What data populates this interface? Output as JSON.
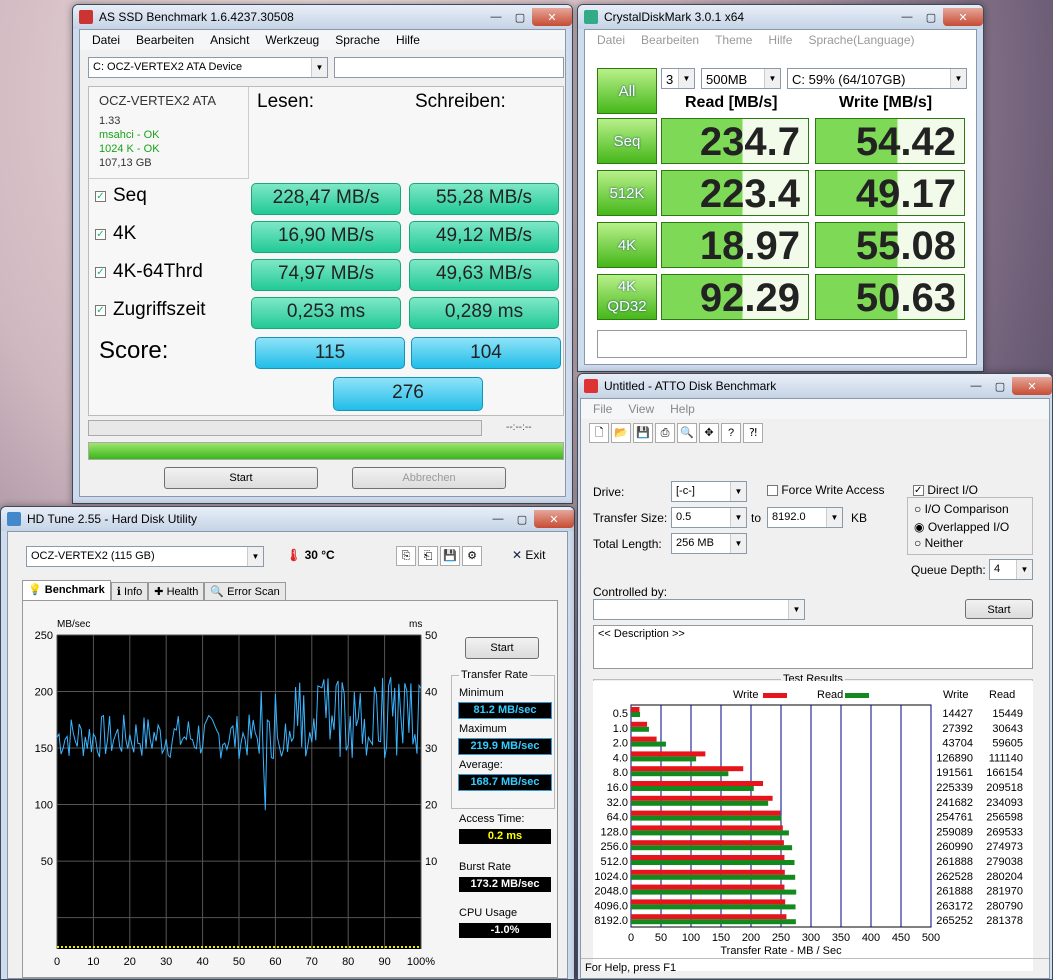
{
  "asssd": {
    "title": "AS SSD Benchmark 1.6.4237.30508",
    "menu": [
      "Datei",
      "Bearbeiten",
      "Ansicht",
      "Werkzeug",
      "Sprache",
      "Hilfe"
    ],
    "device": "C: OCZ-VERTEX2 ATA Device",
    "info": {
      "name": "OCZ-VERTEX2 ATA",
      "fw": "1.33",
      "msahci": "msahci - OK",
      "align": "1024 K - OK",
      "size": "107,13 GB"
    },
    "col_read": "Lesen:",
    "col_write": "Schreiben:",
    "rows": [
      {
        "label": "Seq",
        "read": "228,47 MB/s",
        "write": "55,28 MB/s"
      },
      {
        "label": "4K",
        "read": "16,90 MB/s",
        "write": "49,12 MB/s"
      },
      {
        "label": "4K-64Thrd",
        "read": "74,97 MB/s",
        "write": "49,63 MB/s"
      },
      {
        "label": "Zugriffszeit",
        "read": "0,253 ms",
        "write": "0,289 ms"
      }
    ],
    "score_label": "Score:",
    "score_read": "115",
    "score_write": "104",
    "score_total": "276",
    "time": "--:--:--",
    "progress": 1.0,
    "start": "Start",
    "abort": "Abbrechen"
  },
  "cdm": {
    "title": "CrystalDiskMark 3.0.1 x64",
    "menu": [
      "Datei",
      "Bearbeiten",
      "Theme",
      "Hilfe",
      "Sprache(Language)"
    ],
    "all": "All",
    "count": "3",
    "size": "500MB",
    "drive": "C: 59% (64/107GB)",
    "read_hdr": "Read [MB/s]",
    "write_hdr": "Write [MB/s]",
    "rows": [
      {
        "label": "Seq",
        "read": "234.7",
        "write": "54.42",
        "rf": 0.55,
        "wf": 0.55
      },
      {
        "label": "512K",
        "read": "223.4",
        "write": "49.17",
        "rf": 0.55,
        "wf": 0.55
      },
      {
        "label": "4K",
        "read": "18.97",
        "write": "55.08",
        "rf": 0.55,
        "wf": 0.55
      },
      {
        "label": "4K\nQD32",
        "label1": "4K",
        "label2": "QD32",
        "read": "92.29",
        "write": "50.63",
        "rf": 0.55,
        "wf": 0.55
      }
    ]
  },
  "hdtune": {
    "title": "HD Tune 2.55 - Hard Disk Utility",
    "device": "OCZ-VERTEX2 (115 GB)",
    "temp": "30 °C",
    "exit": "Exit",
    "tabs": [
      "Benchmark",
      "Info",
      "Health",
      "Error Scan"
    ],
    "start": "Start",
    "transfer_rate": "Transfer Rate",
    "min_label": "Minimum",
    "min": "81.2 MB/sec",
    "max_label": "Maximum",
    "max": "219.9 MB/sec",
    "avg_label": "Average:",
    "avg": "168.7 MB/sec",
    "access_label": "Access Time:",
    "access": "0.2 ms",
    "burst_label": "Burst Rate",
    "burst": "173.2 MB/sec",
    "cpu_label": "CPU Usage",
    "cpu": "-1.0%",
    "chart": {
      "ylabel_left": "MB/sec",
      "ylabel_right": "ms",
      "yticks": [
        "250",
        "200",
        "150",
        "100",
        "50"
      ],
      "yticks_r": [
        "50",
        "40",
        "30",
        "20",
        "10"
      ],
      "xticks": [
        "0",
        "10",
        "20",
        "30",
        "40",
        "50",
        "60",
        "70",
        "80",
        "90",
        "100%"
      ]
    }
  },
  "atto": {
    "title": "Untitled - ATTO Disk Benchmark",
    "menu": [
      "File",
      "View",
      "Help"
    ],
    "drive_label": "Drive:",
    "drive": "[-c-]",
    "force_write": "Force Write Access",
    "direct_io": "Direct I/O",
    "ts_label": "Transfer Size:",
    "ts_from": "0.5",
    "to": "to",
    "ts_to": "8192.0",
    "kb": "KB",
    "tl_label": "Total Length:",
    "tl": "256 MB",
    "io_comp": "I/O Comparison",
    "overlapped": "Overlapped I/O",
    "neither": "Neither",
    "qd_label": "Queue Depth:",
    "qd": "4",
    "ctrl_label": "Controlled by:",
    "start": "Start",
    "desc": "<< Description >>",
    "results_label": "Test Results",
    "write_legend": "Write",
    "read_legend": "Read",
    "col_write": "Write",
    "col_read": "Read",
    "xlabel": "Transfer Rate - MB / Sec",
    "status": "For Help, press F1",
    "chart_data": {
      "type": "bar",
      "categories": [
        "0.5",
        "1.0",
        "2.0",
        "4.0",
        "8.0",
        "16.0",
        "32.0",
        "64.0",
        "128.0",
        "256.0",
        "512.0",
        "1024.0",
        "2048.0",
        "4096.0",
        "8192.0"
      ],
      "series": [
        {
          "name": "Write",
          "values": [
            14427,
            27392,
            43704,
            126890,
            191561,
            225339,
            241682,
            254761,
            259089,
            260990,
            261888,
            262528,
            261888,
            263172,
            265252
          ]
        },
        {
          "name": "Read",
          "values": [
            15449,
            30643,
            59605,
            111140,
            166154,
            209518,
            234093,
            256598,
            269533,
            274973,
            279038,
            280204,
            281970,
            280790,
            281378
          ]
        }
      ],
      "xticks": [
        "0",
        "50",
        "100",
        "150",
        "200",
        "250",
        "300",
        "350",
        "400",
        "450",
        "500"
      ],
      "xlim": [
        0,
        500
      ],
      "colors": {
        "write": "#e8141b",
        "read": "#138a1d"
      }
    }
  }
}
